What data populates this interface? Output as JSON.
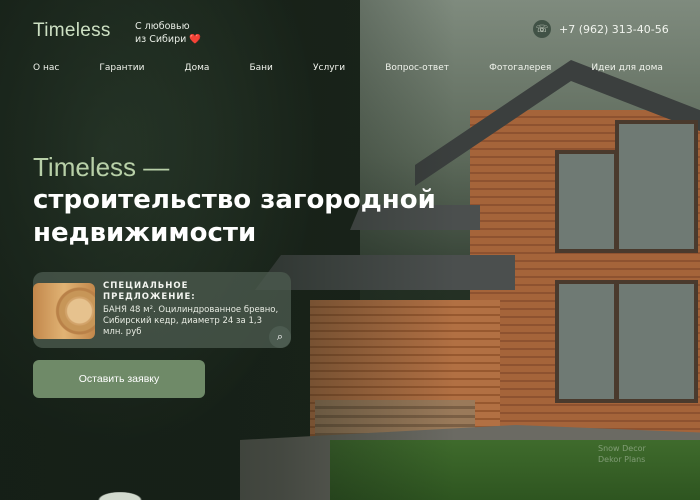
{
  "header": {
    "logo": "Timeless",
    "tagline_line1": "С любовью",
    "tagline_line2": "из Сибири ❤️",
    "phone": "+7 (962) 313-40-56",
    "phone_icon": "phone-icon"
  },
  "nav": [
    {
      "label": "О нас"
    },
    {
      "label": "Гарантии"
    },
    {
      "label": "Дома"
    },
    {
      "label": "Бани"
    },
    {
      "label": "Услуги"
    },
    {
      "label": "Вопрос-ответ"
    },
    {
      "label": "Фотогалерея"
    },
    {
      "label": "Идеи для дома"
    }
  ],
  "hero": {
    "accent": "Timeless —",
    "title": "строительство загородной недвижимости"
  },
  "offer": {
    "title_line1": "СПЕЦИАЛЬНОЕ",
    "title_line2": "ПРЕДЛОЖЕНИЕ:",
    "text": "БАНЯ 48 м². Оцилиндрованное бревно, Сибирский кедр, диаметр 24 за 1,3 млн. руб",
    "search_icon": "search-icon"
  },
  "cta": {
    "label": "Оставить заявку"
  },
  "watermark": {
    "line1": "Snow Decor",
    "line2": "Dekor Plans"
  },
  "colors": {
    "accent": "#b8d0a8",
    "button": "#6f8a68",
    "card": "#4e5c50"
  }
}
